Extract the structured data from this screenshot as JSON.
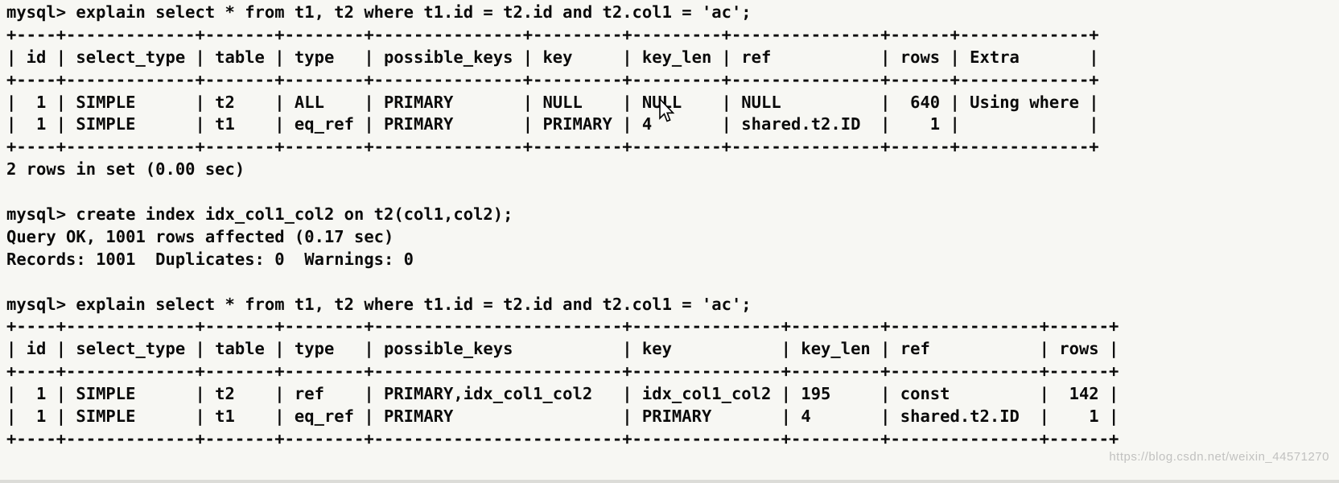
{
  "terminal": {
    "background_color": "#f7f7f3",
    "text_color": "#0a0a0a",
    "prompt": "mysql>",
    "watermark": "https://blog.csdn.net/weixin_44571270",
    "cursor_icon": "mouse-arrow-pointer"
  },
  "blocks": [
    {
      "id": "block-1",
      "command": "mysql> explain select * from t1, t2 where t1.id = t2.id and t2.col1 = 'ac';",
      "table": {
        "columns": [
          "id",
          "select_type",
          "table",
          "type",
          "possible_keys",
          "key",
          "key_len",
          "ref",
          "rows",
          "Extra"
        ],
        "widths": [
          2,
          11,
          5,
          6,
          13,
          7,
          7,
          13,
          4,
          11
        ],
        "aligns": [
          "right",
          "left",
          "left",
          "left",
          "left",
          "left",
          "left",
          "left",
          "right",
          "left"
        ],
        "rows": [
          [
            "1",
            "SIMPLE",
            "t2",
            "ALL",
            "PRIMARY",
            "NULL",
            "NULL",
            "NULL",
            "640",
            "Using where"
          ],
          [
            "1",
            "SIMPLE",
            "t1",
            "eq_ref",
            "PRIMARY",
            "PRIMARY",
            "4",
            "shared.t2.ID",
            "1",
            ""
          ]
        ]
      },
      "status": "2 rows in set (0.00 sec)"
    },
    {
      "id": "block-2",
      "command": "mysql> create index idx_col1_col2 on t2(col1,col2);",
      "output_lines": [
        "Query OK, 1001 rows affected (0.17 sec)",
        "Records: 1001  Duplicates: 0  Warnings: 0"
      ]
    },
    {
      "id": "block-3",
      "command": "mysql> explain select * from t1, t2 where t1.id = t2.id and t2.col1 = 'ac';",
      "table": {
        "columns": [
          "id",
          "select_type",
          "table",
          "type",
          "possible_keys",
          "key",
          "key_len",
          "ref",
          "rows"
        ],
        "widths": [
          2,
          11,
          5,
          6,
          23,
          13,
          7,
          13,
          4
        ],
        "aligns": [
          "right",
          "left",
          "left",
          "left",
          "left",
          "left",
          "left",
          "left",
          "right"
        ],
        "rows": [
          [
            "1",
            "SIMPLE",
            "t2",
            "ref",
            "PRIMARY,idx_col1_col2",
            "idx_col1_col2",
            "195",
            "const",
            "142"
          ],
          [
            "1",
            "SIMPLE",
            "t1",
            "eq_ref",
            "PRIMARY",
            "PRIMARY",
            "4",
            "shared.t2.ID",
            "1"
          ]
        ]
      },
      "truncated_right": true
    }
  ]
}
